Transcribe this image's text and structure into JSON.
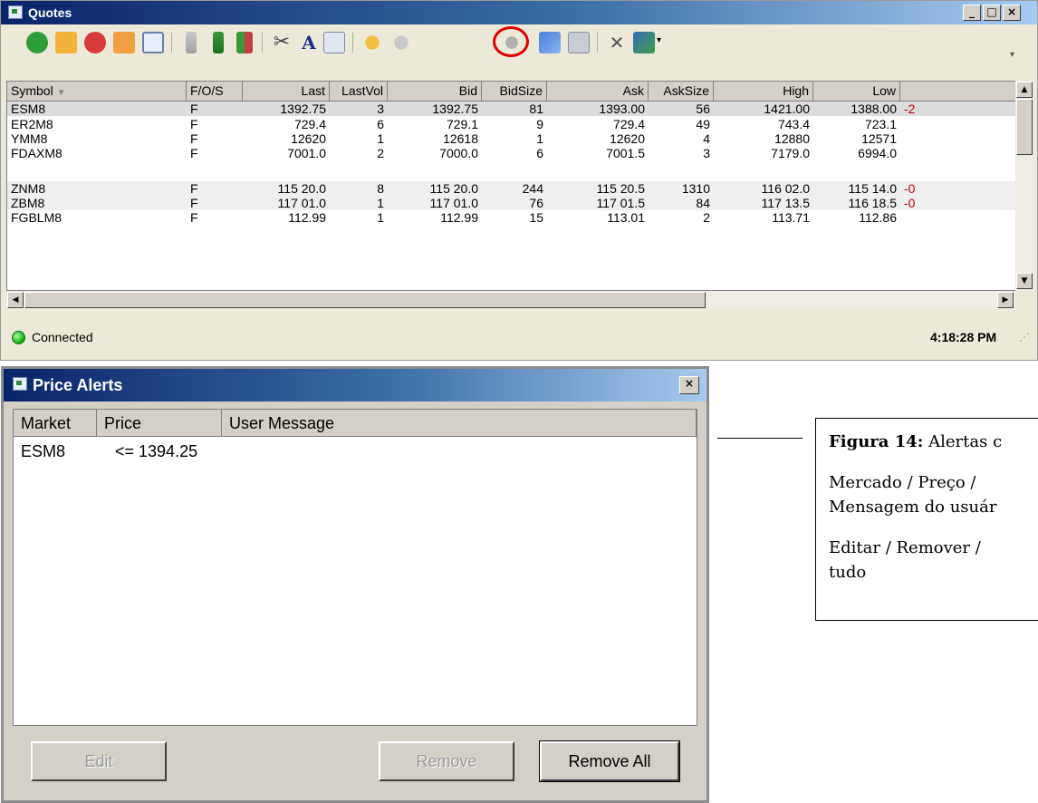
{
  "quotes": {
    "title": "Quotes",
    "columns": [
      "Symbol",
      "F/O/S",
      "Last",
      "LastVol",
      "Bid",
      "BidSize",
      "Ask",
      "AskSize",
      "High",
      "Low"
    ],
    "rows": [
      [
        "ESM8",
        "F",
        "1392.75",
        "3",
        "1392.75",
        "81",
        "1393.00",
        "56",
        "1421.00",
        "1388.00",
        "-2"
      ],
      [
        "ER2M8",
        "F",
        "729.4",
        "6",
        "729.1",
        "9",
        "729.4",
        "49",
        "743.4",
        "723.1",
        ""
      ],
      [
        "YMM8",
        "F",
        "12620",
        "1",
        "12618",
        "1",
        "12620",
        "4",
        "12880",
        "12571",
        ""
      ],
      [
        "FDAXM8",
        "F",
        "7001.0",
        "2",
        "7000.0",
        "6",
        "7001.5",
        "3",
        "7179.0",
        "6994.0",
        ""
      ],
      [
        "",
        "",
        "",
        "",
        "",
        "",
        "",
        "",
        "",
        "",
        ""
      ],
      [
        "ZNM8",
        "F",
        "115 20.0",
        "8",
        "115 20.0",
        "244",
        "115 20.5",
        "1310",
        "116 02.0",
        "115 14.0",
        "-0"
      ],
      [
        "ZBM8",
        "F",
        "117 01.0",
        "1",
        "117 01.0",
        "76",
        "117 01.5",
        "84",
        "117 13.5",
        "116 18.5",
        "-0"
      ],
      [
        "FGBLM8",
        "F",
        "112.99",
        "1",
        "112.99",
        "15",
        "113.01",
        "2",
        "113.71",
        "112.86",
        ""
      ]
    ],
    "status": "Connected",
    "time": "4:18:28 PM",
    "toolbar_icons": [
      "add-icon",
      "open-folder-icon",
      "delete-icon",
      "folder-icon",
      "window-icon",
      "arrow-up-icon",
      "arrow-down-icon",
      "sort-icon",
      "scissors-icon",
      "font-icon",
      "copy-icon",
      "alert-icon",
      "alert-gray-icon",
      "price-alert-icon",
      "chart-icon",
      "picture-icon",
      "tools-icon",
      "export-icon"
    ]
  },
  "alerts": {
    "title": "Price Alerts",
    "columns": [
      "Market",
      "Price",
      "User Message"
    ],
    "rows": [
      [
        "ESM8",
        "<= 1394.25",
        ""
      ]
    ],
    "buttons": {
      "edit": "Edit",
      "remove": "Remove",
      "remove_all": "Remove All"
    }
  },
  "caption": {
    "line1_bold": "Figura 14:",
    "line1_rest": " Alertas c",
    "line2": "Mercado / Preço /",
    "line3": "Mensagem do usuár",
    "line4": "Editar / Remover /",
    "line5": "tudo"
  }
}
